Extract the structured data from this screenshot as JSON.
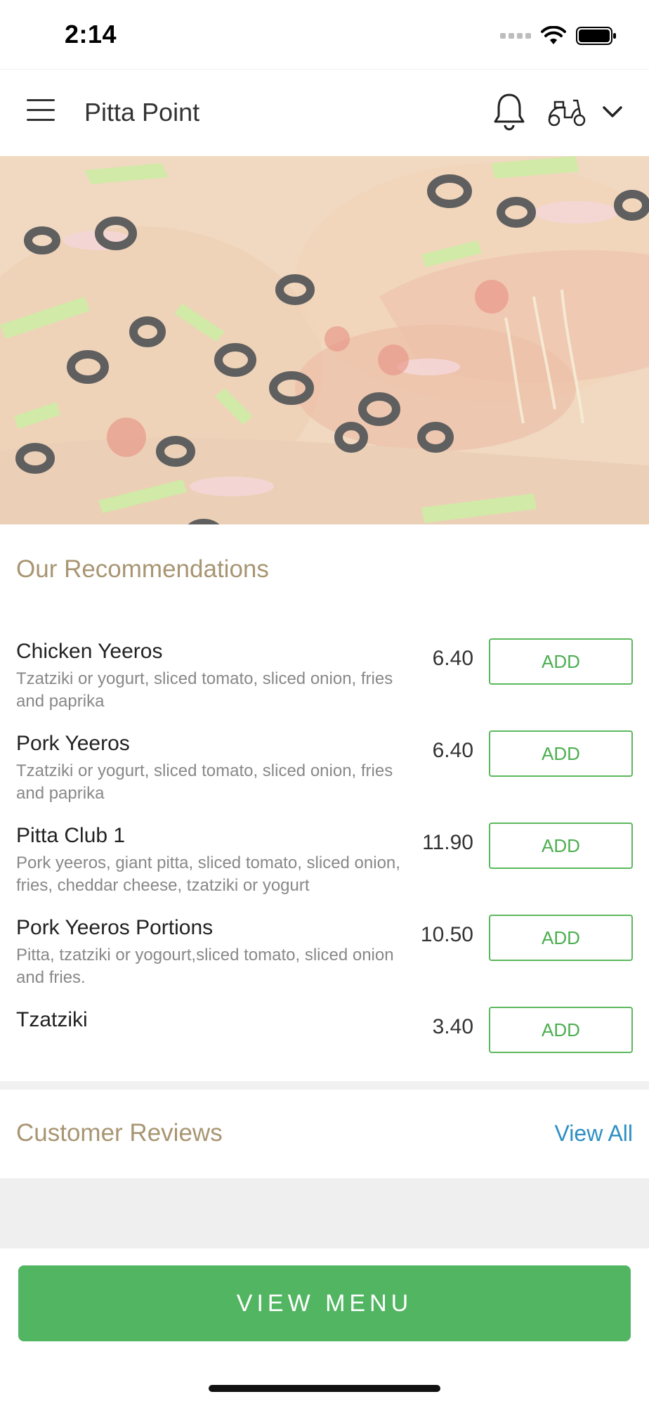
{
  "status_bar": {
    "time": "2:14"
  },
  "header": {
    "title": "Pitta Point",
    "icons": [
      "menu-icon",
      "bell-icon",
      "scooter-icon",
      "chevron-down-icon"
    ]
  },
  "recommendations": {
    "title": "Our Recommendations",
    "add_label": "ADD",
    "items": [
      {
        "name": "Chicken Yeeros",
        "description": "Tzatziki or yogurt, sliced tomato, sliced onion, fries and paprika",
        "price": "6.40"
      },
      {
        "name": "Pork Yeeros",
        "description": "Tzatziki or yogurt, sliced tomato, sliced onion, fries and paprika",
        "price": "6.40"
      },
      {
        "name": "Pitta Club 1",
        "description": "Pork yeeros, giant pitta, sliced tomato, sliced onion, fries, cheddar cheese, tzatziki or yogurt",
        "price": "11.90"
      },
      {
        "name": "Pork Yeeros Portions",
        "description": "Pitta, tzatziki or yogourt,sliced tomato, sliced onion and fries.",
        "price": "10.50"
      },
      {
        "name": "Tzatziki",
        "description": "",
        "price": "3.40"
      }
    ]
  },
  "reviews": {
    "title": "Customer Reviews",
    "view_all": "View All"
  },
  "footer": {
    "view_menu": "VIEW MENU"
  },
  "colors": {
    "accent_green": "#52b562",
    "section_title": "#a89572",
    "link_blue": "#2f8fc2"
  }
}
